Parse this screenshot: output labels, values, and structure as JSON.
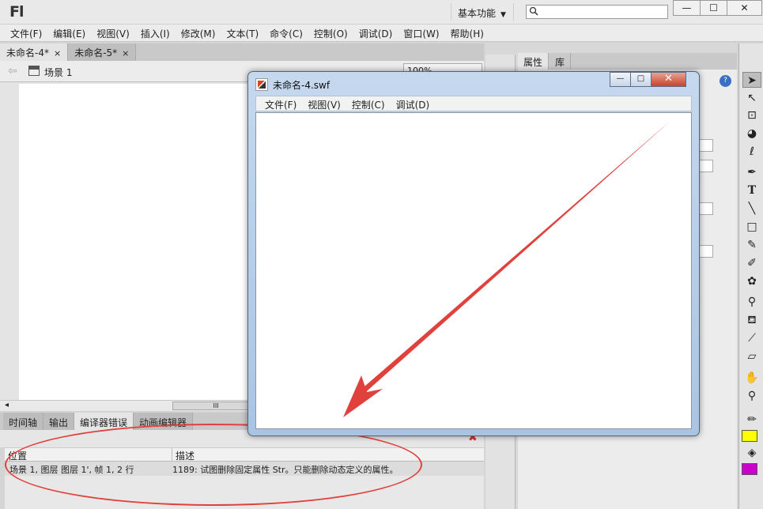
{
  "app": {
    "logo": "Fl",
    "workspace": "基本功能",
    "search": {
      "placeholder": ""
    },
    "window_buttons": {
      "minimize": "—",
      "maximize": "☐",
      "close": "✕"
    }
  },
  "menu": [
    "文件(F)",
    "编辑(E)",
    "视图(V)",
    "插入(I)",
    "修改(M)",
    "文本(T)",
    "命令(C)",
    "控制(O)",
    "调试(D)",
    "窗口(W)",
    "帮助(H)"
  ],
  "doc_tabs": [
    {
      "label": "未命名-4*",
      "close": "×",
      "active": true
    },
    {
      "label": "未命名-5*",
      "close": "×",
      "active": false
    }
  ],
  "scene": {
    "label": "场景 1",
    "zoom": "100%"
  },
  "bottom_tabs": [
    {
      "label": "时间轴",
      "active": false
    },
    {
      "label": "输出",
      "active": false
    },
    {
      "label": "编译器错误",
      "active": true
    },
    {
      "label": "动画编辑器",
      "active": false
    }
  ],
  "errors": {
    "col_location": "位置",
    "col_description": "描述",
    "rows": [
      {
        "location": "场景 1, 图层 图层 1', 帧 1, 2 行",
        "description": "1189: 试图删除固定属性 Str。只能删除动态定义的属性。"
      }
    ]
  },
  "properties": {
    "tabs": [
      "属性",
      "库"
    ]
  },
  "swf_window": {
    "title": "未命名-4.swf",
    "menu": [
      "文件(F)",
      "视图(V)",
      "控制(C)",
      "调试(D)"
    ],
    "buttons": {
      "minimize": "—",
      "maximize": "□",
      "close": "✕"
    }
  },
  "tools": [
    "selection",
    "subselection",
    "free-transform",
    "3d-rotation",
    "lasso",
    "pen",
    "text",
    "line",
    "rectangle",
    "pencil",
    "brush",
    "deco",
    "bone",
    "paint-bucket",
    "eyedropper",
    "eraser",
    "hand",
    "zoom"
  ],
  "colors": {
    "stroke_color": "#ffff00",
    "fill_color": "#cc00cc",
    "annotation": "#e0413c"
  }
}
